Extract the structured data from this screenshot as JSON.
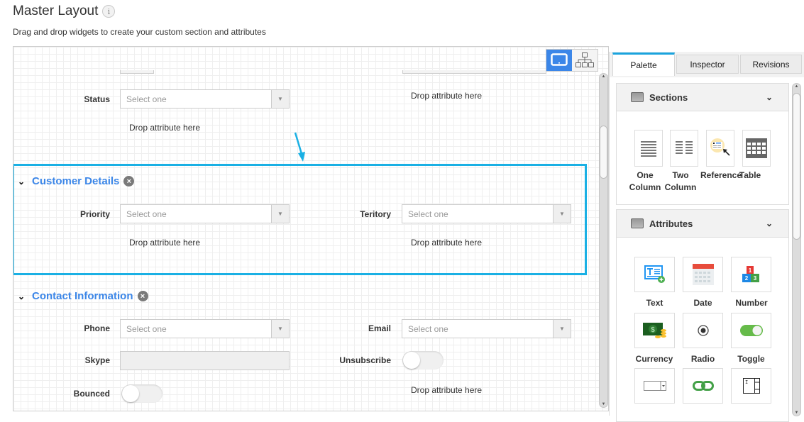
{
  "header": {
    "title": "Master Layout",
    "info_icon": "info-icon",
    "subtitle": "Drag and drop widgets to create your custom section and attributes"
  },
  "canvas": {
    "view_modes": [
      {
        "name": "desktop-view",
        "icon": "monitor-icon",
        "active": true
      },
      {
        "name": "hierarchy-view",
        "icon": "sitemap-icon",
        "active": false
      }
    ],
    "top_section": {
      "fields": [
        {
          "label": "Status",
          "type": "select",
          "placeholder": "Select one"
        }
      ],
      "drop_left": "Drop attribute here",
      "drop_right": "Drop attribute here"
    },
    "sections": [
      {
        "title": "Customer Details",
        "highlighted": true,
        "left": {
          "label": "Priority",
          "placeholder": "Select one",
          "drop": "Drop attribute here"
        },
        "right": {
          "label": "Teritory",
          "placeholder": "Select one",
          "drop": "Drop attribute here"
        }
      },
      {
        "title": "Contact Information",
        "highlighted": false,
        "left": [
          {
            "label": "Phone",
            "type": "select",
            "placeholder": "Select one"
          },
          {
            "label": "Skype",
            "type": "text",
            "value": ""
          },
          {
            "label": "Bounced",
            "type": "toggle",
            "on": false
          }
        ],
        "right": [
          {
            "label": "Email",
            "type": "select",
            "placeholder": "Select one"
          },
          {
            "label": "Unsubscribe",
            "type": "toggle",
            "on": false
          }
        ],
        "drop_right": "Drop attribute here"
      }
    ],
    "highlight_color": "#1ab0e4",
    "section_title_color": "#3b86e8"
  },
  "panel": {
    "tabs": [
      {
        "label": "Palette",
        "active": true
      },
      {
        "label": "Inspector",
        "active": false
      },
      {
        "label": "Revisions",
        "active": false
      }
    ],
    "groups": [
      {
        "title": "Sections",
        "items": [
          {
            "label_line1": "One",
            "label_line2": "Column",
            "icon": "one-column-icon"
          },
          {
            "label_line1": "Two",
            "label_line2": "Column",
            "icon": "two-column-icon"
          },
          {
            "label_line1": "Reference",
            "label_line2": "",
            "icon": "reference-icon"
          },
          {
            "label_line1": "Table",
            "label_line2": "",
            "icon": "table-icon"
          }
        ]
      },
      {
        "title": "Attributes",
        "items": [
          {
            "label": "Text",
            "icon": "text-field-icon"
          },
          {
            "label": "Date",
            "icon": "calendar-icon"
          },
          {
            "label": "Number",
            "icon": "number-icon"
          },
          {
            "label": "Currency",
            "icon": "currency-icon"
          },
          {
            "label": "Radio",
            "icon": "radio-icon"
          },
          {
            "label": "Toggle",
            "icon": "toggle-icon"
          },
          {
            "label": "",
            "icon": "dropdown-icon"
          },
          {
            "label": "",
            "icon": "link-icon"
          },
          {
            "label": "",
            "icon": "text-area-icon"
          }
        ]
      }
    ]
  }
}
